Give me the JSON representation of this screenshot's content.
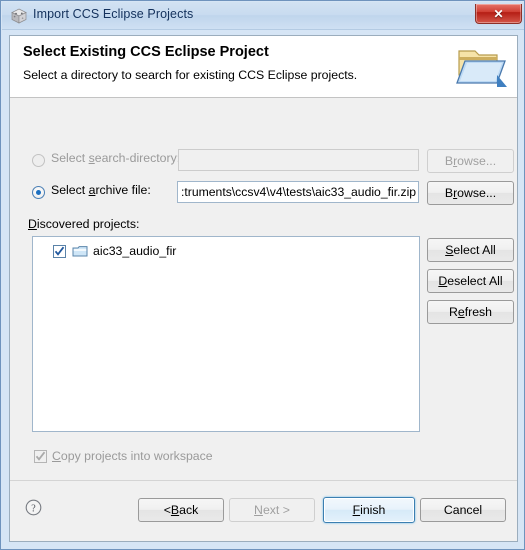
{
  "window": {
    "title": "Import CCS Eclipse Projects",
    "title_icon": "ccs-cube-icon",
    "close_label": "✕"
  },
  "header": {
    "title": "Select Existing CCS Eclipse Project",
    "subtitle": "Select a directory to search for existing CCS Eclipse projects.",
    "icon": "open-folder-icon"
  },
  "form": {
    "search_directory": {
      "label_before": "Select ",
      "label_mnemonic": "s",
      "label_after": "earch-directory:",
      "value": "",
      "selected": false,
      "enabled": false
    },
    "archive_file": {
      "label_before": "Select ",
      "label_mnemonic": "a",
      "label_after": "rchive file:",
      "value": ":truments\\ccsv4\\v4\\tests\\aic33_audio_fir.zip",
      "selected": true,
      "enabled": true
    },
    "browse_top": {
      "label_before": "B",
      "label_mnemonic": "r",
      "label_after": "owse...",
      "enabled": false
    },
    "browse_bottom": {
      "label_before": "B",
      "label_mnemonic": "r",
      "label_after": "owse...",
      "enabled": true
    }
  },
  "projects": {
    "label_before": "D",
    "label_mnemonic": "i",
    "label_after": "scovered projects:",
    "items": [
      {
        "name": "aic33_audio_fir",
        "checked": true,
        "icon": "project-folder-icon"
      }
    ]
  },
  "list_buttons": [
    {
      "before": "",
      "mnemonic": "S",
      "after": "elect All",
      "name": "select-all-button"
    },
    {
      "before": "",
      "mnemonic": "D",
      "after": "eselect All",
      "name": "deselect-all-button"
    },
    {
      "before": "R",
      "mnemonic": "e",
      "after": "fresh",
      "name": "refresh-button"
    }
  ],
  "copy_projects": {
    "before": "",
    "mnemonic": "C",
    "after": "opy projects into workspace",
    "checked": true,
    "enabled": false
  },
  "footer": {
    "help_icon": "help-question-icon",
    "buttons": [
      {
        "before": "< ",
        "mnemonic": "B",
        "after": "ack",
        "enabled": true,
        "default": false,
        "name": "back-button"
      },
      {
        "before": "",
        "mnemonic": "N",
        "after": "ext >",
        "enabled": false,
        "default": false,
        "name": "next-button"
      },
      {
        "before": "",
        "mnemonic": "F",
        "after": "inish",
        "enabled": true,
        "default": true,
        "name": "finish-button"
      },
      {
        "before": "Cancel",
        "mnemonic": "",
        "after": "",
        "enabled": true,
        "default": false,
        "name": "cancel-button"
      }
    ]
  },
  "colors": {
    "titlebar": "#c8dbf0",
    "window_border": "#6f93bd",
    "close_red": "#cf3d32",
    "accent_blue": "#1c6fc0",
    "disabled_text": "#9a9a9a"
  }
}
